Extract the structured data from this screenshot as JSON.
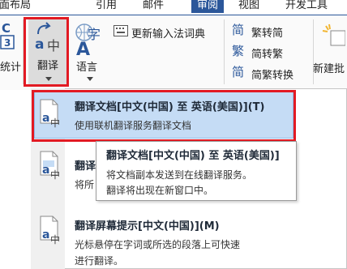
{
  "tabs": {
    "first": "页面布局",
    "second": "引用",
    "third": "邮件",
    "active": "审阅",
    "fifth": "视图",
    "sixth": "开发工具"
  },
  "ribbon": {
    "stat_label": "统计",
    "translate_label": "翻译",
    "language_label": "语言",
    "update_ime": "更新输入法词典",
    "trad_to_simp": "繁转简",
    "simp_to_trad": "简转繁",
    "convert": "简繁转换",
    "new_comment": "新建批"
  },
  "menu": {
    "item1_title": "翻译文档[中文(中国) 至 英语(美国)](T)",
    "item1_desc": "使用联机翻译服务翻译文档",
    "item2_title_partial": "翻译",
    "item2_desc_partial": "将所",
    "item3_title": "翻译屏幕提示[中文(中国)](M)",
    "item3_desc_line1": "光标悬停在字词或所选的段落上可快速",
    "item3_desc_line2": "进行翻译。"
  },
  "tooltip": {
    "title": "翻译文档[中文(中国) 至 英语(美国)]",
    "line1": "将文档副本发送到在线翻译服务。",
    "line2": "翻译将出现在新窗口中。"
  },
  "colors": {
    "accent": "#2b579a",
    "highlight_red": "#e21a23",
    "menu_hover": "#c5dcf5"
  }
}
